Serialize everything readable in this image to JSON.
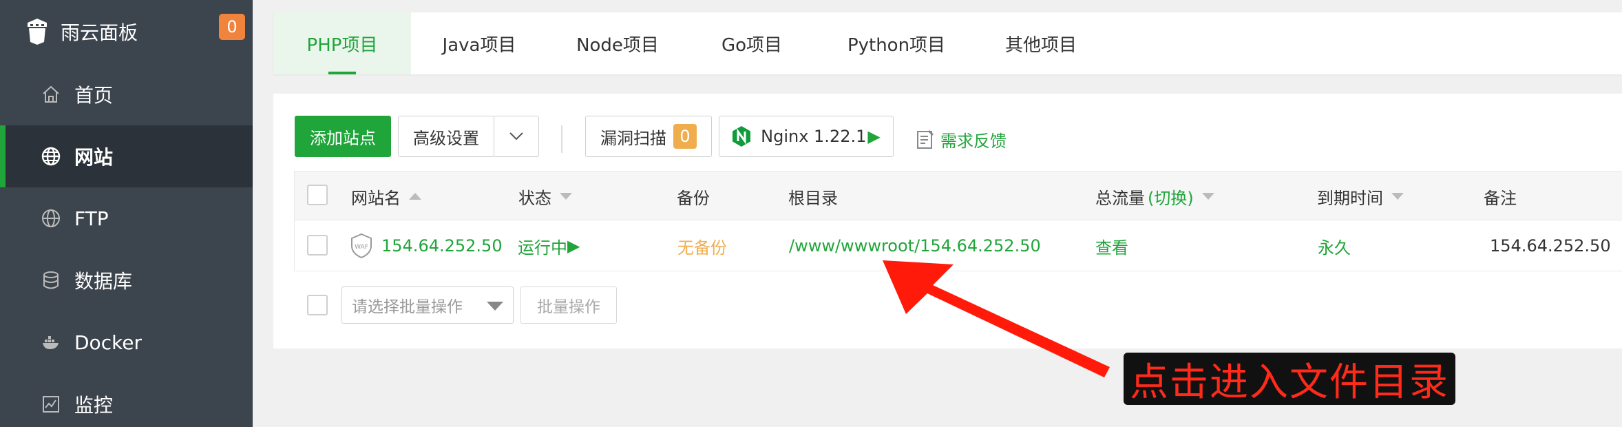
{
  "brand": {
    "name": "雨云面板",
    "badge": "0"
  },
  "sidebar": {
    "items": [
      {
        "label": "首页",
        "icon": "home-icon"
      },
      {
        "label": "网站",
        "icon": "globe-icon",
        "active": true
      },
      {
        "label": "FTP",
        "icon": "ftp-globe-icon"
      },
      {
        "label": "数据库",
        "icon": "database-icon"
      },
      {
        "label": "Docker",
        "icon": "docker-icon"
      },
      {
        "label": "监控",
        "icon": "monitor-icon"
      }
    ]
  },
  "tabs": [
    {
      "label": "PHP项目",
      "active": true
    },
    {
      "label": "Java项目"
    },
    {
      "label": "Node项目"
    },
    {
      "label": "Go项目"
    },
    {
      "label": "Python项目"
    },
    {
      "label": "其他项目"
    }
  ],
  "toolbar": {
    "add_site": "添加站点",
    "advanced": "高级设置",
    "scan": "漏洞扫描",
    "scan_count": "0",
    "nginx": "Nginx 1.22.1",
    "feedback": "需求反馈"
  },
  "table": {
    "headers": {
      "name": "网站名",
      "status": "状态",
      "backup": "备份",
      "root": "根目录",
      "traffic": "总流量",
      "traffic_switch": "(切换)",
      "expire": "到期时间",
      "remark": "备注"
    },
    "rows": [
      {
        "name": "154.64.252.50",
        "waf_label": "WAF",
        "status": "运行中",
        "backup": "无备份",
        "root": "/www/wwwroot/154.64.252.50",
        "traffic": "查看",
        "expire": "永久",
        "remark": "154.64.252.50"
      }
    ]
  },
  "batch": {
    "placeholder": "请选择批量操作",
    "button": "批量操作"
  },
  "annotation": {
    "text": "点击进入文件目录"
  },
  "colors": {
    "accent": "#20a53a",
    "sidebar": "#3c444d",
    "badge": "#f0843c",
    "warning": "#f0ad4e",
    "arrow": "#ff1a0a"
  }
}
